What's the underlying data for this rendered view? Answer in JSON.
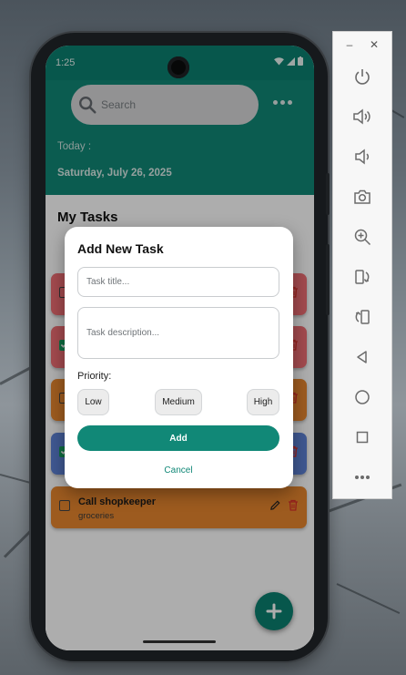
{
  "status_bar": {
    "time": "1:25"
  },
  "search": {
    "placeholder": "Search"
  },
  "header": {
    "today_label": "Today :",
    "date": "Saturday, July 26, 2025"
  },
  "section_title": "My Tasks",
  "tasks": [
    {
      "title": "",
      "description": "",
      "color": "#ef6e74",
      "done": false
    },
    {
      "title": "",
      "description": "",
      "color": "#ef6e74",
      "done": true
    },
    {
      "title": "",
      "description": "",
      "color": "#e8872f",
      "done": false
    },
    {
      "title": "",
      "description": "",
      "color": "#5e82d6",
      "done": true
    },
    {
      "title": "Call shopkeeper",
      "description": "groceries",
      "color": "#e8872f",
      "done": false
    }
  ],
  "dialog": {
    "title": "Add New Task",
    "title_placeholder": "Task title...",
    "description_placeholder": "Task description...",
    "priority_label": "Priority:",
    "priorities": [
      "Low",
      "Medium",
      "High"
    ],
    "add_label": "Add",
    "cancel_label": "Cancel"
  },
  "colors": {
    "primary": "#118877",
    "status_bar": "#0b8070",
    "delete_icon": "#d9302a"
  },
  "emulator_toolbar": {
    "window_controls": [
      "minimize-icon",
      "close-icon"
    ],
    "buttons": [
      "power-icon",
      "volume-up-icon",
      "volume-down-icon",
      "camera-icon",
      "zoom-icon",
      "rotate-left-icon",
      "rotate-right-icon",
      "back-icon",
      "home-icon",
      "overview-icon",
      "more-icon"
    ]
  }
}
